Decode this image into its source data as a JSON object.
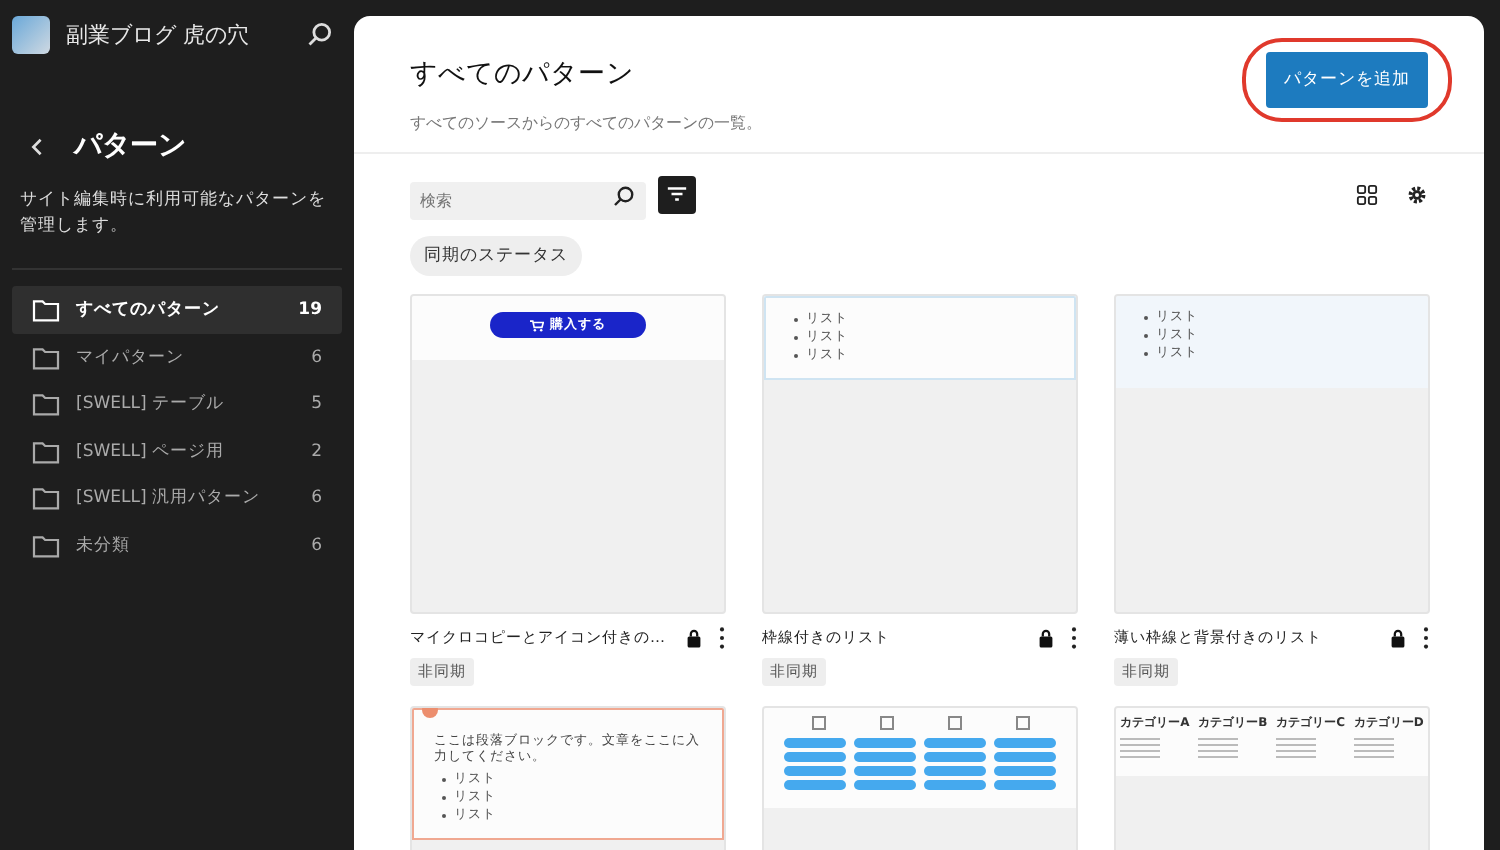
{
  "site": {
    "title": "副業ブログ 虎の穴"
  },
  "sidebar": {
    "heading": "パターン",
    "description": "サイト編集時に利用可能なパターンを管理します。",
    "items": [
      {
        "label": "すべてのパターン",
        "count": "19",
        "selected": true
      },
      {
        "label": "マイパターン",
        "count": "6",
        "selected": false
      },
      {
        "label": "[SWELL] テーブル",
        "count": "5",
        "selected": false
      },
      {
        "label": "[SWELL] ページ用",
        "count": "2",
        "selected": false
      },
      {
        "label": "[SWELL] 汎用パターン",
        "count": "6",
        "selected": false
      },
      {
        "label": "未分類",
        "count": "6",
        "selected": false
      }
    ]
  },
  "header": {
    "title": "すべてのパターン",
    "subtitle": "すべてのソースからのすべてのパターンの一覧。",
    "add_button": {
      "label": "パターンを追加",
      "highlighted": true
    }
  },
  "toolbar": {
    "search": {
      "placeholder": "検索"
    },
    "filter_chip": "同期のステータス"
  },
  "cards": [
    {
      "kind": "button",
      "preview_text": [
        "購入する"
      ],
      "title": "マイクロコピーとアイコン付きの…",
      "badge": "非同期",
      "locked": true
    },
    {
      "kind": "bordered-list",
      "preview_text": [
        "リスト",
        "リスト",
        "リスト"
      ],
      "title": "枠線付きのリスト",
      "badge": "非同期",
      "locked": true
    },
    {
      "kind": "tinted-list",
      "preview_text": [
        "リスト",
        "リスト",
        "リスト"
      ],
      "title": "薄い枠線と背景付きのリスト",
      "badge": "非同期",
      "locked": true
    },
    {
      "kind": "paragraph-box",
      "preview_text": [
        "ここは段落ブロックです。文章をここに入力してください。",
        "リスト",
        "リスト",
        "リスト"
      ]
    },
    {
      "kind": "pill-grid"
    },
    {
      "kind": "category-columns",
      "preview_text": [
        "カテゴリーA",
        "カテゴリーB",
        "カテゴリーC",
        "カテゴリーD"
      ]
    }
  ]
}
